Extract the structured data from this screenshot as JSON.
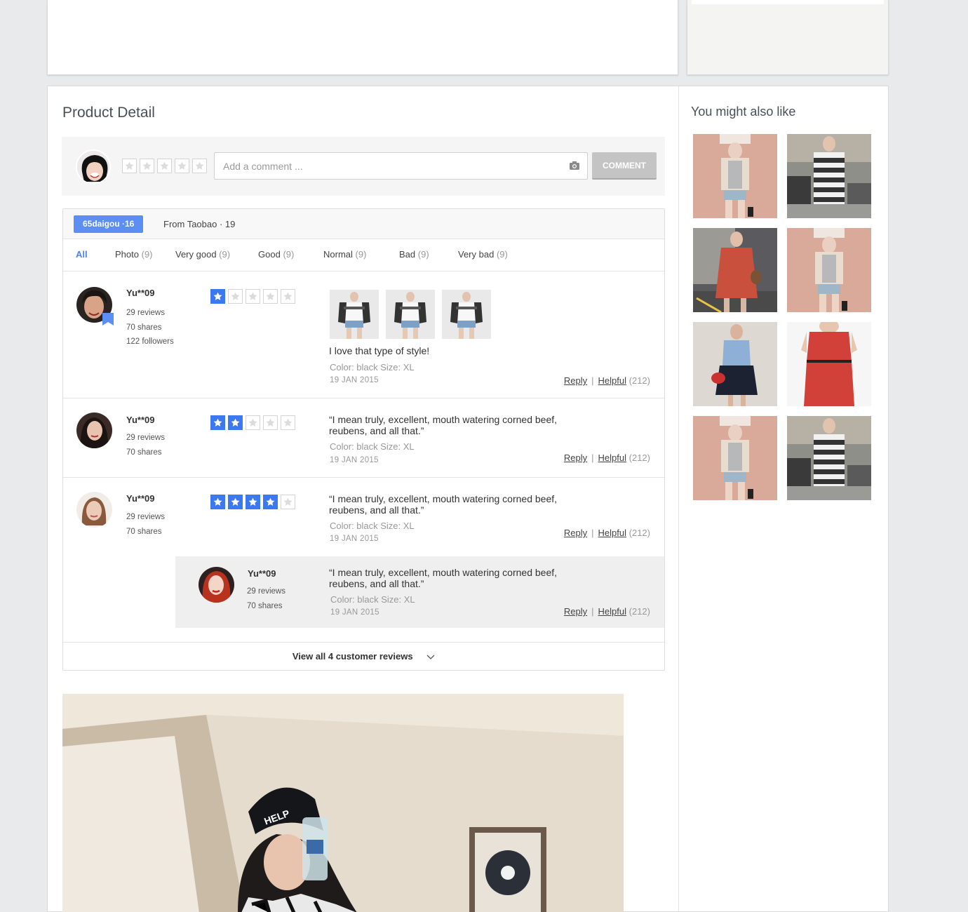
{
  "product_detail": {
    "title": "Product Detail"
  },
  "comment": {
    "placeholder": "Add a comment ...",
    "button_label": "COMMENT",
    "rating": 0
  },
  "sources": {
    "active_label": "65daigou ·16",
    "other_label": "From Taobao · 19"
  },
  "filters": [
    {
      "label": "All",
      "count": ""
    },
    {
      "label": "Photo",
      "count": "(9)"
    },
    {
      "label": "Very good",
      "count": "(9)"
    },
    {
      "label": "Good",
      "count": "(9)"
    },
    {
      "label": "Normal",
      "count": "(9)"
    },
    {
      "label": "Bad",
      "count": "(9)"
    },
    {
      "label": "Very bad",
      "count": "(9)"
    }
  ],
  "reviews": [
    {
      "user": "Yu**09",
      "reviews": "29 reviews",
      "shares": "70 shares",
      "followers": "122 followers",
      "rating": 1,
      "text": "I love that type of style!",
      "meta": "Color: black   Size: XL",
      "date": "19 JAN 2015",
      "reply": "Reply",
      "helpful": "Helpful",
      "helpful_count": "(212)"
    },
    {
      "user": "Yu**09",
      "reviews": "29 reviews",
      "shares": "70 shares",
      "rating": 2,
      "text": "“I mean truly, excellent, mouth watering corned beef, reubens, and all that.”",
      "meta": "Color: black   Size: XL",
      "date": "19 JAN 2015",
      "reply": "Reply",
      "helpful": "Helpful",
      "helpful_count": "(212)"
    },
    {
      "user": "Yu**09",
      "reviews": "29 reviews",
      "shares": "70 shares",
      "rating": 4,
      "text": "“I mean truly, excellent, mouth watering corned beef, reubens, and all that.”",
      "meta": "Color: black   Size: XL",
      "date": "19 JAN 2015",
      "reply": "Reply",
      "helpful": "Helpful",
      "helpful_count": "(212)"
    }
  ],
  "nested_reply": {
    "user": "Yu**09",
    "reviews": "29 reviews",
    "shares": "70 shares",
    "text": "“I mean truly, excellent, mouth watering corned beef, reubens, and all that.”",
    "meta": "Color: black   Size: XL",
    "date": "19 JAN 2015",
    "reply": "Reply",
    "helpful": "Helpful",
    "helpful_count": "(212)"
  },
  "view_all": "View all 4 customer reviews",
  "sidebar": {
    "title": "You might also like"
  },
  "colors": {
    "accent": "#3c78f0",
    "badge": "#5c8ef4",
    "button_disabled": "#c4c4c4"
  }
}
